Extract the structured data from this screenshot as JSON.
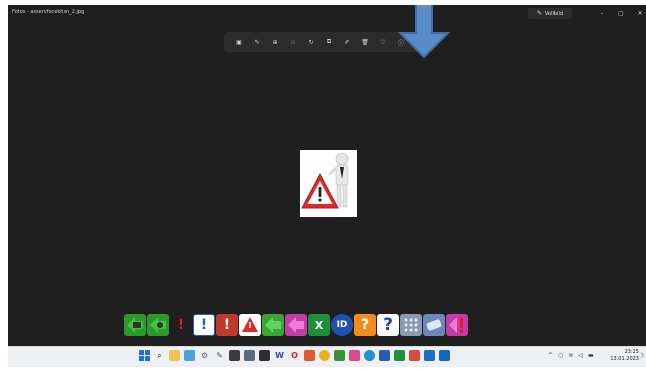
{
  "window": {
    "title": "Fotos - asservfocekhsn_2.jpg",
    "edit_label": "Vollbild",
    "minimize": "–",
    "maximize": "▢",
    "close": "✕"
  },
  "toolbar": {
    "tools": [
      {
        "icon": "view-icon",
        "glyph": "▣"
      },
      {
        "icon": "edit-icon",
        "glyph": "✎"
      },
      {
        "icon": "zoom-in-icon",
        "glyph": "⊕"
      },
      {
        "icon": "zoom-out-icon",
        "glyph": "⊖"
      },
      {
        "icon": "rotate-icon",
        "glyph": "↻"
      },
      {
        "icon": "crop-icon",
        "glyph": "⧉"
      },
      {
        "icon": "markup-icon",
        "glyph": "✐"
      },
      {
        "icon": "delete-icon",
        "glyph": "🗑"
      },
      {
        "icon": "favorite-icon",
        "glyph": "♡"
      },
      {
        "icon": "info-icon",
        "glyph": "ⓘ"
      },
      {
        "icon": "more-icon",
        "glyph": "⋯"
      }
    ]
  },
  "clock": {
    "time": "23:25",
    "date": "13.01.2023"
  },
  "colors": {
    "window_bg": "#1f1f1f",
    "toolbar_bg": "#2b2b2b",
    "arrow": "#5b8bc9",
    "taskbar_bg": "#eef0f4"
  }
}
